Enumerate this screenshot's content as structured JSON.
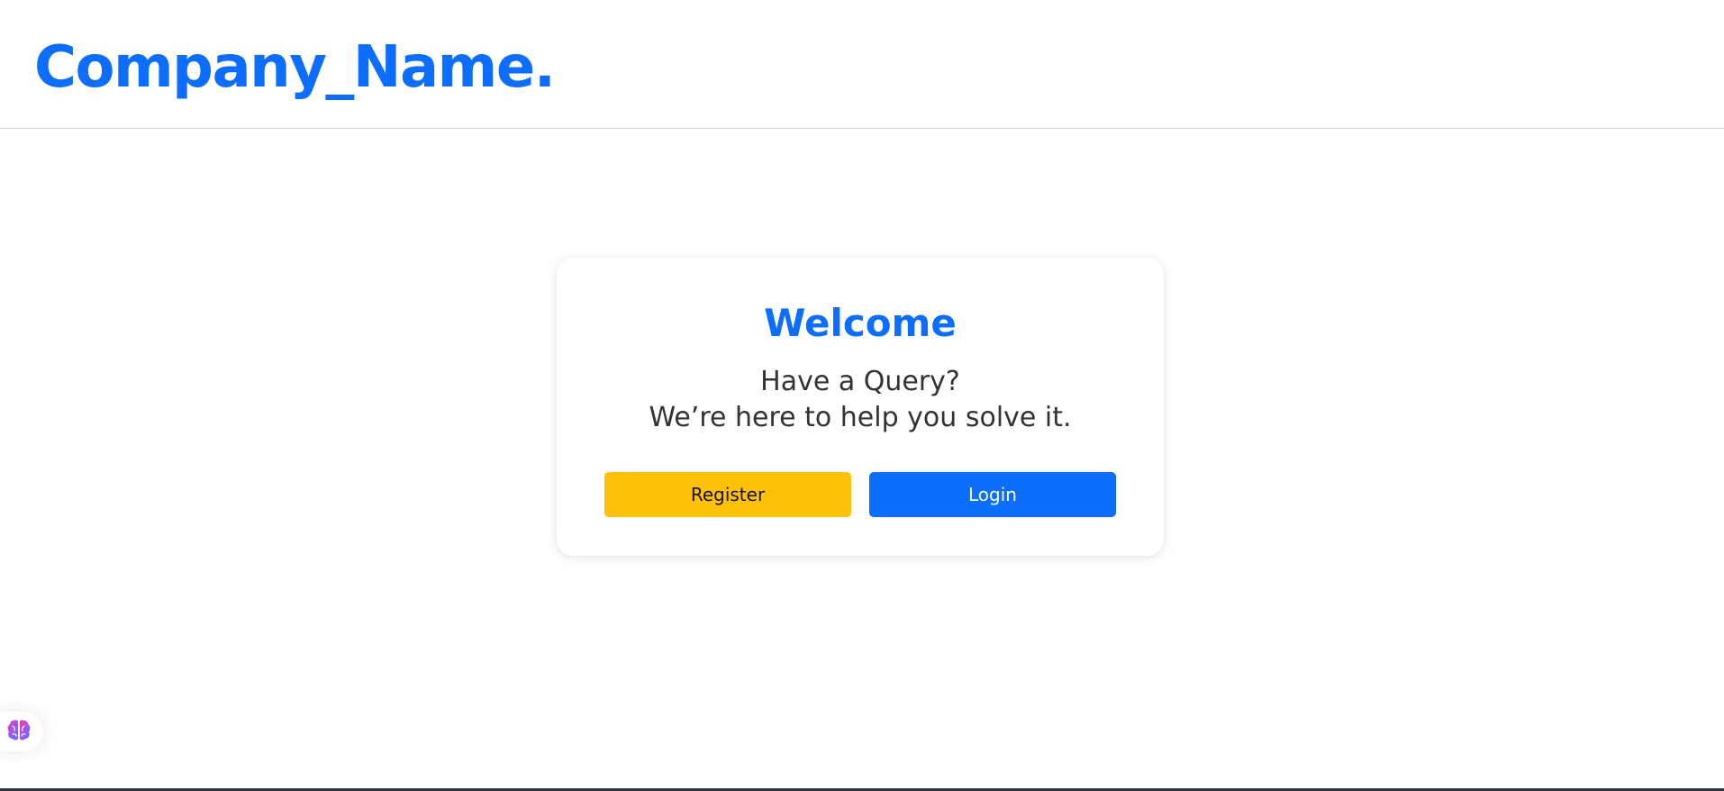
{
  "header": {
    "brand": "Company_Name."
  },
  "card": {
    "title": "Welcome",
    "subtitle_line1": "Have a Query?",
    "subtitle_line2": "We’re here to help you solve it.",
    "register_label": "Register",
    "login_label": "Login"
  },
  "assistant": {
    "icon": "brain-icon"
  },
  "colors": {
    "brand": "#0d6efd",
    "register_button": "#ffc107",
    "login_button": "#0d6efd",
    "heading_text": "#333333"
  }
}
